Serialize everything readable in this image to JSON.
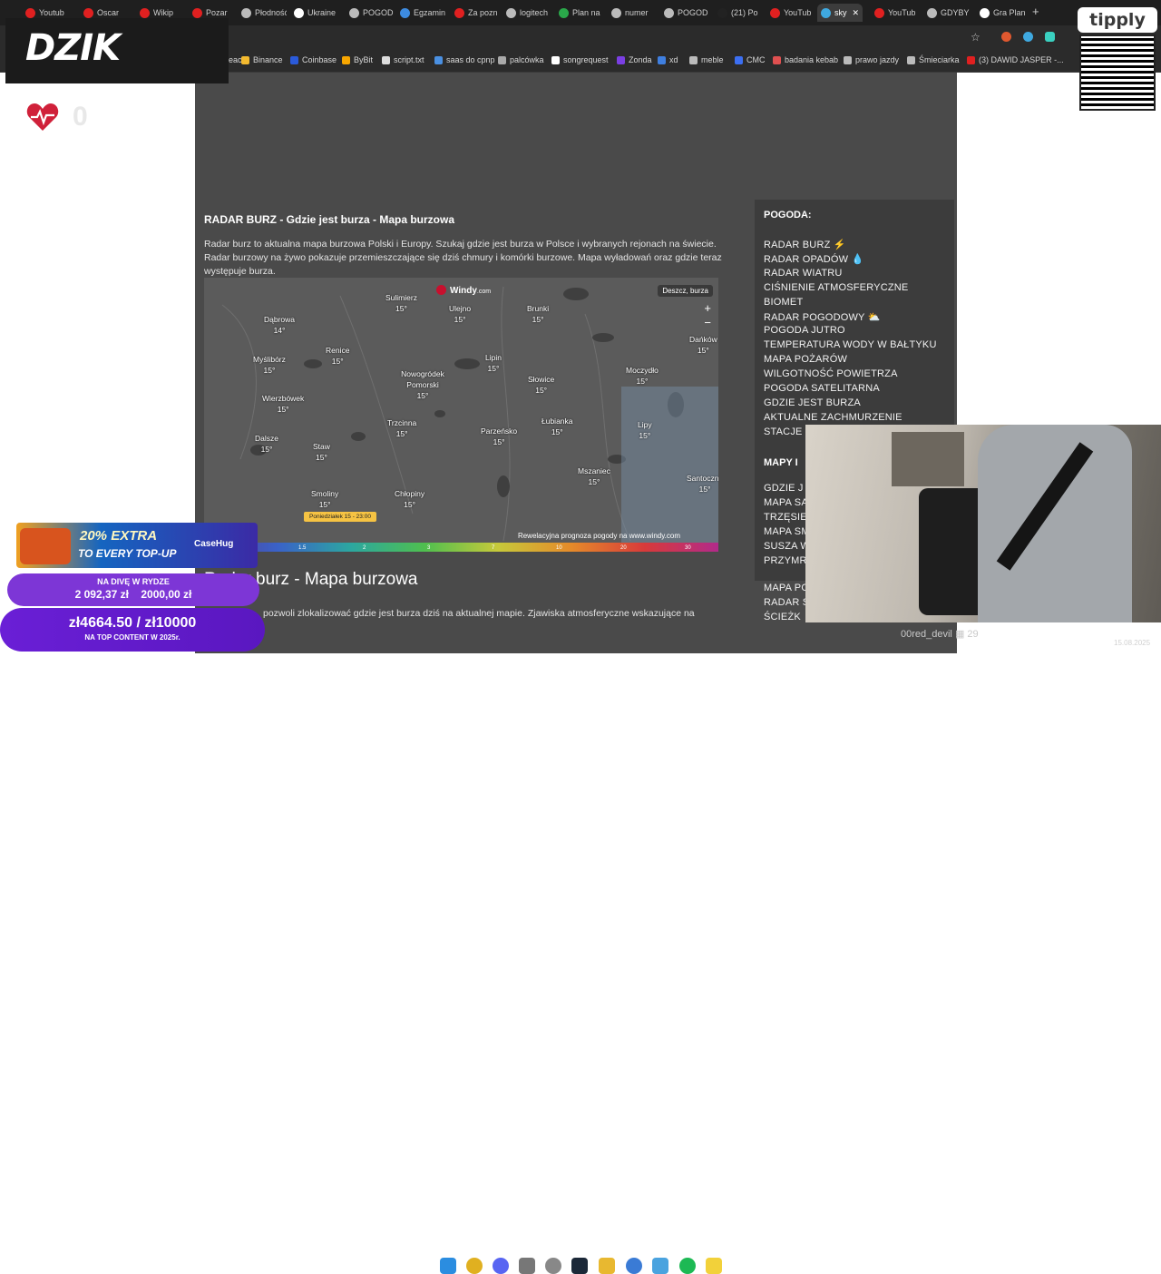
{
  "browser": {
    "tabs": [
      "Youtub",
      "Oscar",
      "Wikip",
      "Pozar",
      "Płodność",
      "Ukraine",
      "POGOD",
      "Egzamin",
      "Za pozn",
      "logitech",
      "Plan na",
      "numer",
      "POGOD",
      "(21) Po",
      "YouTub",
      "sky",
      "YouTub",
      "GDYBY",
      "Gra Plan"
    ],
    "active_tab": "sky",
    "close_glyph": "✕",
    "new_tab_glyph": "+",
    "bookmarks": [
      "react",
      "Binance",
      "Coinbase",
      "ByBit",
      "script.txt",
      "saas do cpnp",
      "palcówka",
      "songrequest",
      "Zonda",
      "xd",
      "meble",
      "CMC",
      "badania kebab",
      "prawo jazdy",
      "Śmieciarka",
      "(3) DAWID JASPER -..."
    ],
    "colors": {
      "tabbar": "#1f1f1f",
      "toolbar": "#2b2b2b",
      "accent": "#4fc3f7"
    }
  },
  "overlay": {
    "logo": "DZIK",
    "counter": "0",
    "tipply": "tipply",
    "casehug": {
      "extra": "20% EXTRA",
      "topup": "TO EVERY TOP-UP",
      "brand": "CaseHug"
    },
    "goal1": {
      "title": "NA DIVĘ W RYDZE",
      "current": "2 092,37 zł",
      "target": "2000,00 zł"
    },
    "goal2": {
      "amount": "zł4664.50 / zł10000",
      "sub": "NA TOP CONTENT W 2025r."
    },
    "chat_user": "00red_devil",
    "chat_count": "29",
    "date": "15.08.2025"
  },
  "page": {
    "radar_heading": "RADAR BURZ - Gdzie jest burza - Mapa burzowa",
    "intro": "Radar burz to aktualna mapa burzowa Polski i Europy. Szukaj gdzie jest burza w Polsce i wybranych rejonach na świecie. Radar burzowy na żywo pokazuje przemieszczające się dziś chmury i komórki burzowe. Mapa wyładowań oraz gdzie teraz występuje burza.",
    "big_heading": "Radar burz - Mapa burzowa",
    "body_fragment": "pozwoli zlokalizować gdzie jest burza dziś na aktualnej mapie. Zjawiska atmosferyczne wskazujące na"
  },
  "map": {
    "brand": "Windy",
    "brand_suffix": ".com",
    "layer": "Deszcz, burza",
    "time_chip": "Poniedziałek 15 - 23:00",
    "promo": "Rewelacyjna prognoza pogody na www.windy.com",
    "scale": [
      "1.5",
      "2",
      "3",
      "7",
      "10",
      "20",
      "30"
    ],
    "cities": [
      {
        "name": "Sulimierz",
        "temp": "15°"
      },
      {
        "name": "Ulejno",
        "temp": "15°"
      },
      {
        "name": "Brunki",
        "temp": "15°"
      },
      {
        "name": "Dąbrowa",
        "temp": "14°"
      },
      {
        "name": "Renice",
        "temp": "15°"
      },
      {
        "name": "Myślibórz",
        "temp": "15°"
      },
      {
        "name": "Nowogródek Pomorski",
        "temp": "15°"
      },
      {
        "name": "Lipin",
        "temp": "15°"
      },
      {
        "name": "Moczydło",
        "temp": "15°"
      },
      {
        "name": "Dańków",
        "temp": "15°"
      },
      {
        "name": "Słowice",
        "temp": "15°"
      },
      {
        "name": "Wierzbówek",
        "temp": "15°"
      },
      {
        "name": "Trzcinna",
        "temp": "15°"
      },
      {
        "name": "Parzeńsko",
        "temp": "15°"
      },
      {
        "name": "Łubianka",
        "temp": "15°"
      },
      {
        "name": "Lipy",
        "temp": "15°"
      },
      {
        "name": "Dalsze",
        "temp": "15°"
      },
      {
        "name": "Staw",
        "temp": "15°"
      },
      {
        "name": "Mszaniec",
        "temp": "15°"
      },
      {
        "name": "Santoczno",
        "temp": "15°"
      },
      {
        "name": "Smoliny",
        "temp": "15°"
      },
      {
        "name": "Chłopiny",
        "temp": "15°"
      }
    ]
  },
  "sidebar": {
    "title": "POGODA:",
    "links": [
      "RADAR BURZ ⚡",
      "RADAR OPADÓW 💧",
      "RADAR WIATRU",
      "CIŚNIENIE ATMOSFERYCZNE",
      "BIOMET",
      "RADAR POGODOWY ⛅",
      "POGODA JUTRO",
      "TEMPERATURA WODY W BAŁTYKU",
      "MAPA POŻARÓW",
      "WILGOTNOŚĆ POWIETRZA",
      "POGODA SATELITARNA",
      "GDZIE JEST BURZA",
      "AKTUALNE ZACHMURZENIE",
      "STACJE"
    ],
    "section2": "MAPY I",
    "links2": [
      "GDZIE J",
      "MAPA SA",
      "TRZĘSIE",
      "MAPA SM",
      "SUSZA W",
      "PRZYMR"
    ],
    "links3": [
      "MAPA PO",
      "RADAR S",
      "ŚCIEŻK"
    ]
  }
}
